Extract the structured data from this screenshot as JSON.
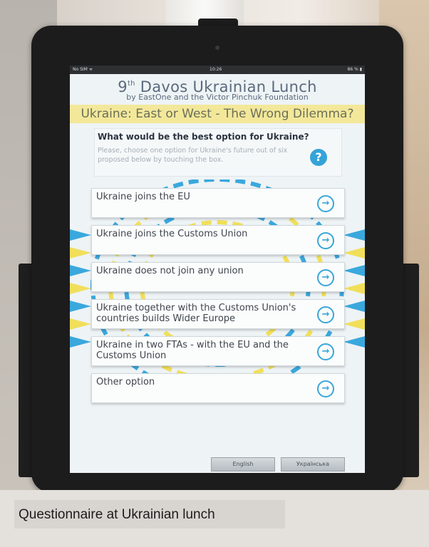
{
  "status": {
    "carrier": "No SIM ᯤ",
    "time": "10:26",
    "battery": "86 % ▮"
  },
  "header": {
    "title_main": "Davos Ukrainian Lunch",
    "title_ordinal": "9",
    "title_sup": "th",
    "subtitle": "by EastOne and the Victor Pinchuk Foundation",
    "topic": "Ukraine: East or West - The Wrong Dilemma?"
  },
  "question": {
    "text": "What would be the best option for Ukraine?",
    "instructions": "Please, choose one option for Ukraine's future out of six proposed below by touching the box.",
    "help_icon": "?"
  },
  "options": [
    {
      "label": "Ukraine joins the EU"
    },
    {
      "label": "Ukraine joins the Customs Union"
    },
    {
      "label": "Ukraine does not join any union"
    },
    {
      "label": "Ukraine together with the Customs Union's countries builds Wider Europe"
    },
    {
      "label": "Ukraine in two FTAs - with the EU and the Customs Union"
    },
    {
      "label": "Other option"
    }
  ],
  "arrow_glyph": "→",
  "languages": {
    "english": "English",
    "ukrainian": "Українська"
  },
  "caption": "Questionnaire at Ukrainian lunch",
  "colors": {
    "accent": "#35a3d8",
    "topic_band": "#f3e89a",
    "emblem_yellow": "#f1df5a",
    "emblem_blue": "#3aa8dd"
  }
}
